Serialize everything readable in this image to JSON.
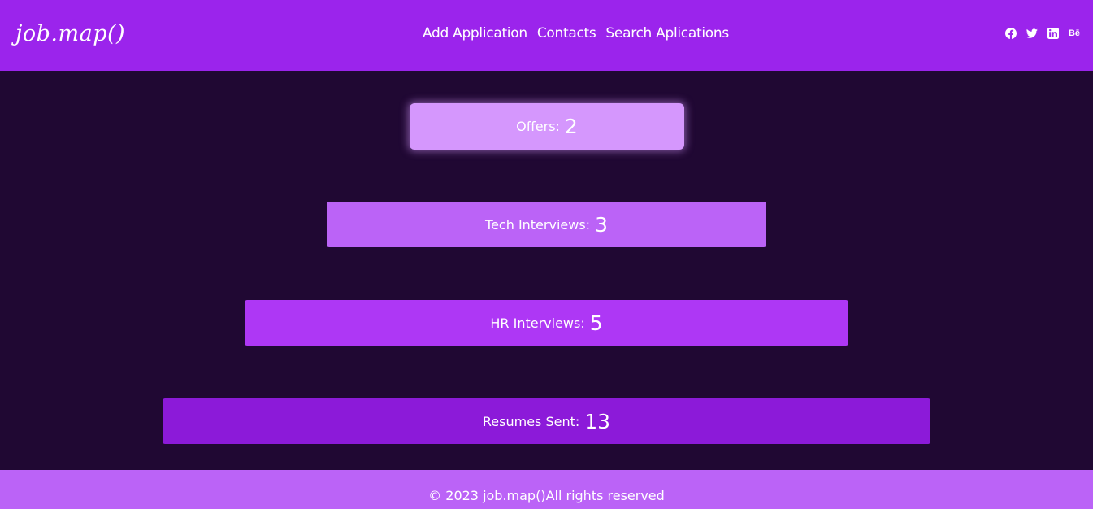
{
  "header": {
    "logo": "job.map()",
    "nav": {
      "add_application": "Add Application",
      "contacts": "Contacts",
      "search_applications": "Search Aplications"
    },
    "social": {
      "facebook": "facebook-icon",
      "twitter": "twitter-icon",
      "linkedin": "linkedin-icon",
      "behance_label": "Bē"
    }
  },
  "funnel": {
    "offers": {
      "label": "Offers:",
      "value": "2"
    },
    "tech_interviews": {
      "label": "Tech Interviews:",
      "value": "3"
    },
    "hr_interviews": {
      "label": "HR Interviews:",
      "value": "5"
    },
    "resumes_sent": {
      "label": "Resumes Sent:",
      "value": "13"
    }
  },
  "footer": {
    "text": "© 2023 job.map()All rights reserved"
  },
  "colors": {
    "header_bg": "#9b24ec",
    "page_bg": "#200833",
    "offers_bg": "#d597fd",
    "tech_bg": "#bb63f7",
    "hr_bg": "#ae37f5",
    "resumes_bg": "#8c1ad9",
    "footer_bg": "#bb63f7"
  }
}
